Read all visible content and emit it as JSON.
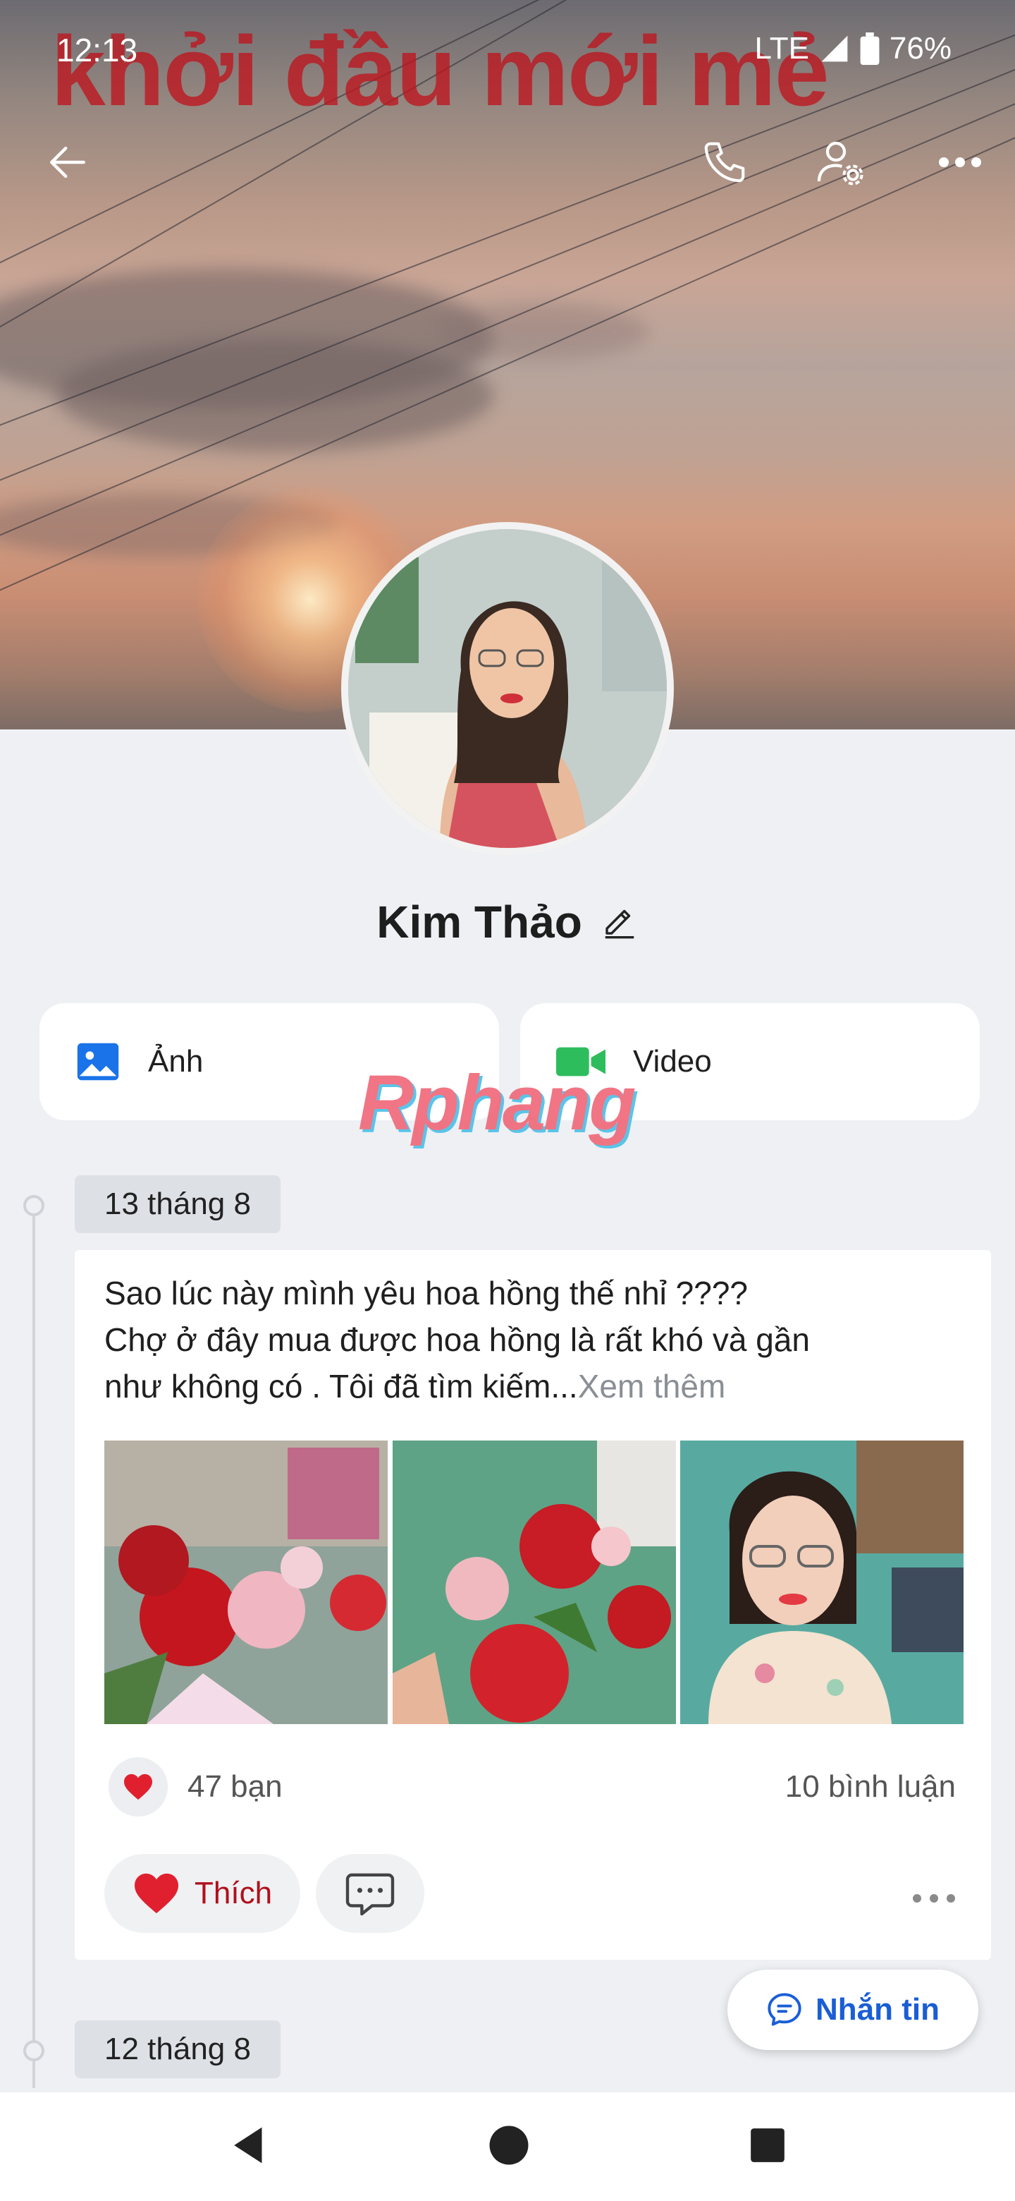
{
  "status_bar": {
    "time": "12:13",
    "network": "LTE",
    "battery": "76%"
  },
  "cover": {
    "overlay_text": "khởi đầu mới mẻ"
  },
  "profile": {
    "name": "Kim Thảo"
  },
  "media_buttons": [
    {
      "label": "Ảnh",
      "icon": "image-icon",
      "color": "#1a73e8"
    },
    {
      "label": "Video",
      "icon": "video-camera-icon",
      "color": "#2ebd5c"
    }
  ],
  "watermark": "Rphang",
  "timeline": [
    {
      "date": "13 tháng 8",
      "post": {
        "text_line1": "Sao lúc này mình yêu hoa hồng thế nhỉ ????",
        "text_line2": "Chợ ở đây mua được hoa hồng là rất khó và gần",
        "text_line3": "như không có . Tôi đã tìm kiếm...",
        "see_more": "Xem thêm",
        "reactions": "47 bạn",
        "comments": "10 bình luận",
        "like_label": "Thích"
      }
    },
    {
      "date": "12 tháng 8"
    }
  ],
  "message_button": "Nhắn tin",
  "colors": {
    "accent": "#1a5ed6",
    "like": "#b0101c",
    "heart": "#e0202f"
  }
}
